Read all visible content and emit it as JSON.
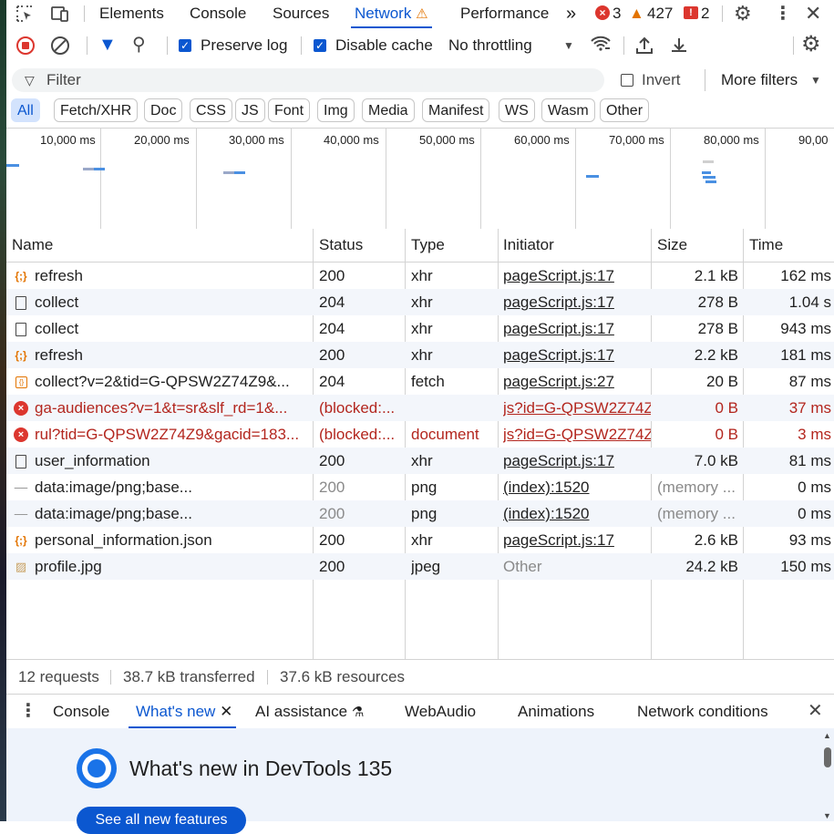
{
  "tabs": {
    "items": [
      "Elements",
      "Console",
      "Sources",
      "Network",
      "Performance"
    ],
    "active": "Network",
    "more": "»",
    "errors": "3",
    "warnings": "427",
    "issues": "2"
  },
  "toolbar": {
    "preserve_log": "Preserve log",
    "disable_cache": "Disable cache",
    "throttling": "No throttling"
  },
  "filter": {
    "placeholder": "Filter",
    "invert": "Invert",
    "more_filters": "More filters"
  },
  "type_filters": [
    "All",
    "Fetch/XHR",
    "Doc",
    "CSS",
    "JS",
    "Font",
    "Img",
    "Media",
    "Manifest",
    "WS",
    "Wasm",
    "Other"
  ],
  "overview": {
    "ticks": [
      "10,000 ms",
      "20,000 ms",
      "30,000 ms",
      "40,000 ms",
      "50,000 ms",
      "60,000 ms",
      "70,000 ms",
      "80,000 ms",
      "90,00"
    ]
  },
  "table": {
    "columns": [
      "Name",
      "Status",
      "Type",
      "Initiator",
      "Size",
      "Time"
    ],
    "rows": [
      {
        "icon": "xhr",
        "name": "refresh",
        "status": "200",
        "type": "xhr",
        "initiator": "pageScript.js:17",
        "size": "2.1 kB",
        "time": "162 ms",
        "state": "normal"
      },
      {
        "icon": "doc",
        "name": "collect",
        "status": "204",
        "type": "xhr",
        "initiator": "pageScript.js:17",
        "size": "278 B",
        "time": "1.04 s",
        "state": "normal"
      },
      {
        "icon": "doc",
        "name": "collect",
        "status": "204",
        "type": "xhr",
        "initiator": "pageScript.js:17",
        "size": "278 B",
        "time": "943 ms",
        "state": "normal"
      },
      {
        "icon": "xhr",
        "name": "refresh",
        "status": "200",
        "type": "xhr",
        "initiator": "pageScript.js:17",
        "size": "2.2 kB",
        "time": "181 ms",
        "state": "normal"
      },
      {
        "icon": "fetch",
        "name": "collect?v=2&tid=G-QPSW2Z74Z9&...",
        "status": "204",
        "type": "fetch",
        "initiator": "pageScript.js:27",
        "size": "20 B",
        "time": "87 ms",
        "state": "normal"
      },
      {
        "icon": "error",
        "name": "ga-audiences?v=1&t=sr&slf_rd=1&...",
        "status": "(blocked:...",
        "type": "",
        "initiator": "js?id=G-QPSW2Z74Z",
        "size": "0 B",
        "time": "37 ms",
        "state": "error"
      },
      {
        "icon": "error",
        "name": "rul?tid=G-QPSW2Z74Z9&gacid=183...",
        "status": "(blocked:...",
        "type": "document",
        "initiator": "js?id=G-QPSW2Z74Z",
        "size": "0 B",
        "time": "3 ms",
        "state": "error"
      },
      {
        "icon": "doc",
        "name": "user_information",
        "status": "200",
        "type": "xhr",
        "initiator": "pageScript.js:17",
        "size": "7.0 kB",
        "time": "81 ms",
        "state": "normal"
      },
      {
        "icon": "data",
        "name": "data:image/png;base...",
        "status": "200",
        "type": "png",
        "initiator": "(index):1520",
        "size": "(memory ...",
        "time": "0 ms",
        "state": "cached"
      },
      {
        "icon": "data",
        "name": "data:image/png;base...",
        "status": "200",
        "type": "png",
        "initiator": "(index):1520",
        "size": "(memory ...",
        "time": "0 ms",
        "state": "cached"
      },
      {
        "icon": "xhr",
        "name": "personal_information.json",
        "status": "200",
        "type": "xhr",
        "initiator": "pageScript.js:17",
        "size": "2.6 kB",
        "time": "93 ms",
        "state": "normal"
      },
      {
        "icon": "img",
        "name": "profile.jpg",
        "status": "200",
        "type": "jpeg",
        "initiator": "Other",
        "size": "24.2 kB",
        "time": "150 ms",
        "state": "other"
      }
    ]
  },
  "summary": {
    "requests": "12 requests",
    "transferred": "38.7 kB transferred",
    "resources": "37.6 kB resources"
  },
  "drawer": {
    "tabs": [
      "Console",
      "What's new",
      "AI assistance",
      "WebAudio",
      "Animations",
      "Network conditions"
    ],
    "active": "What's new",
    "heading": "What's new in DevTools 135",
    "button": "See all new features"
  }
}
